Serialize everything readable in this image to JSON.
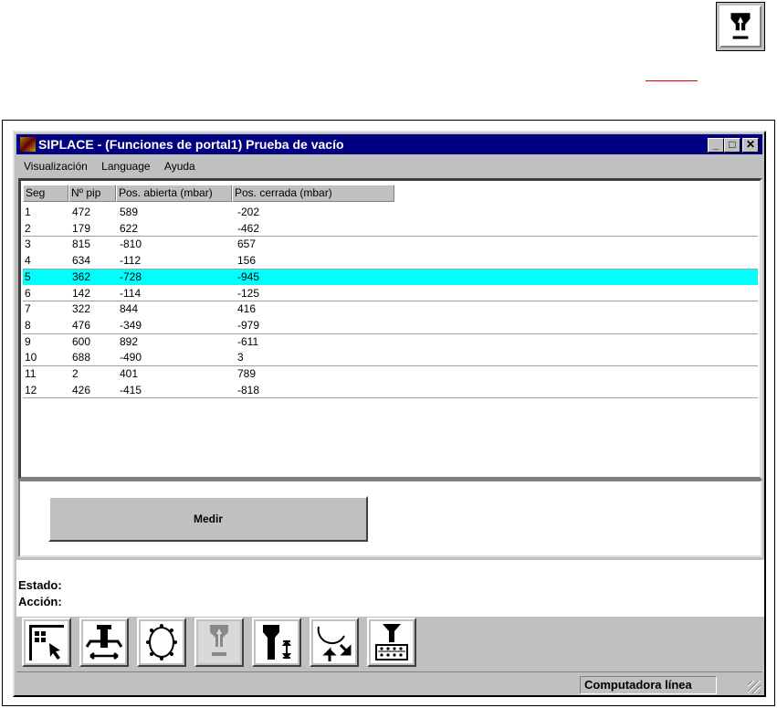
{
  "window": {
    "title": "SIPLACE - (Funciones de portal1) Prueba de vacío",
    "minimize": "_",
    "maximize": "□",
    "close": "✕"
  },
  "menu": [
    "Visualización",
    "Language",
    "Ayuda"
  ],
  "table": {
    "columns": [
      "Seg",
      "Nº pip",
      "Pos. abierta (mbar)",
      "Pos. cerrada (mbar)"
    ],
    "selected_row": 5,
    "rows": [
      [
        "1",
        "472",
        "589",
        "-202"
      ],
      [
        "2",
        "179",
        "622",
        "-462"
      ],
      [
        "3",
        "815",
        "-810",
        "657"
      ],
      [
        "4",
        "634",
        "-112",
        "156"
      ],
      [
        "5",
        "362",
        "-728",
        "-945"
      ],
      [
        "6",
        "142",
        "-114",
        "-125"
      ],
      [
        "7",
        "322",
        "844",
        "416"
      ],
      [
        "8",
        "476",
        "-349",
        "-979"
      ],
      [
        "9",
        "600",
        "892",
        "-611"
      ],
      [
        "10",
        "688",
        "-490",
        "3"
      ],
      [
        "11",
        "2",
        "401",
        "789"
      ],
      [
        "12",
        "426",
        "-415",
        "-818"
      ]
    ]
  },
  "measure_button": "Medir",
  "status": {
    "estado_label": "Estado:",
    "accion_label": "Acción:"
  },
  "toolbar": [
    "select-grid-icon",
    "gantry-move-icon",
    "revolver-head-icon",
    "vacuum-test-icon",
    "nozzle-height-icon",
    "segment-rotate-icon",
    "nozzle-changer-icon"
  ],
  "statusbar": {
    "text": "Computadora línea"
  },
  "colors": {
    "title_bar": "#000080",
    "selection": "#00ffff",
    "annotation_line": "#e00000"
  }
}
